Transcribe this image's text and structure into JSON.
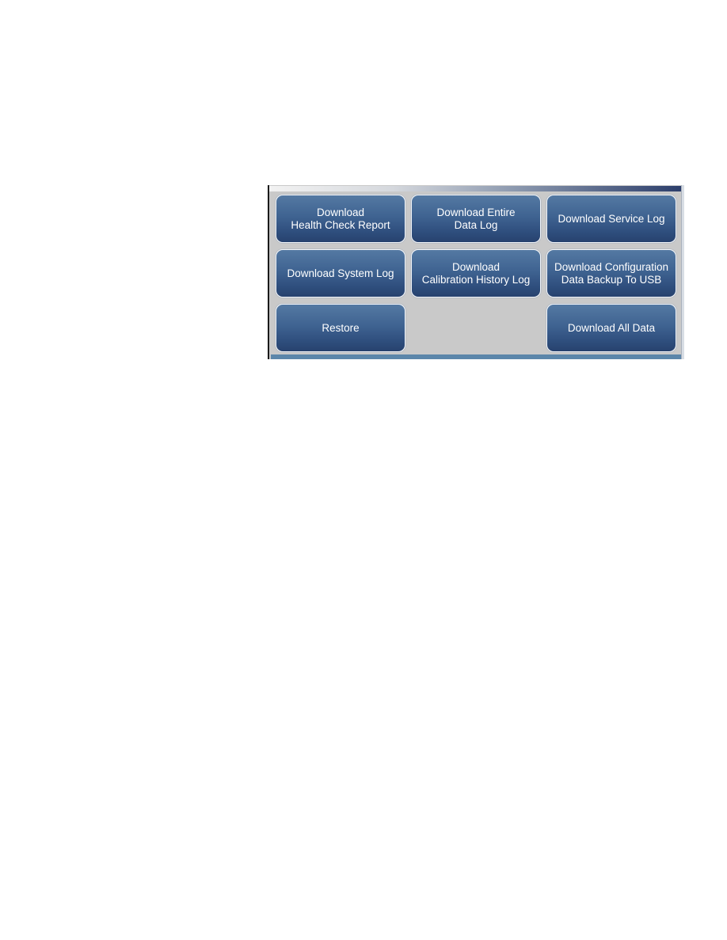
{
  "panel": {
    "buttons": [
      {
        "id": "download-health-check-report",
        "lines": [
          "Download",
          "Health Check Report"
        ]
      },
      {
        "id": "download-entire-data-log",
        "lines": [
          "Download Entire",
          "Data Log"
        ]
      },
      {
        "id": "download-service-log",
        "lines": [
          "Download Service Log"
        ]
      },
      {
        "id": "download-system-log",
        "lines": [
          "Download System Log"
        ]
      },
      {
        "id": "download-calibration-history-log",
        "lines": [
          "Download",
          "Calibration History Log"
        ]
      },
      {
        "id": "download-configuration-data-backup",
        "lines": [
          "Download Configuration",
          "Data Backup To USB"
        ]
      },
      {
        "id": "restore",
        "lines": [
          "Restore"
        ]
      },
      {
        "id": "download-all-data",
        "lines": [
          "Download All Data"
        ]
      }
    ]
  },
  "colors": {
    "button_top": "#5479a3",
    "button_bottom": "#27426e",
    "panel_background": "#c9c9c9",
    "bottom_bar": "#5b86aa",
    "title_bar_dark": "#2c3e6b"
  }
}
